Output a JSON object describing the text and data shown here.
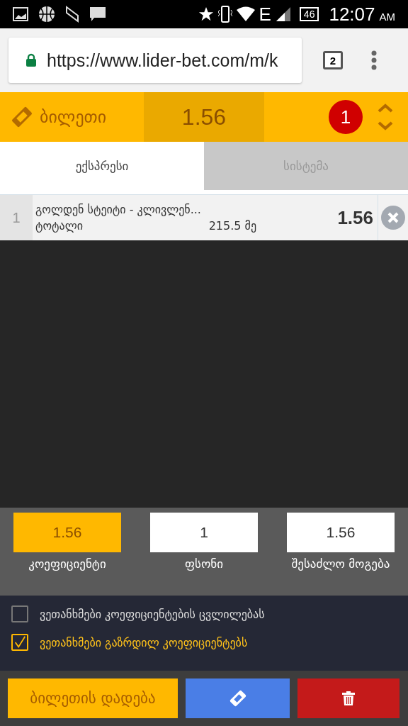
{
  "status_bar": {
    "network": "E",
    "battery": "46",
    "time": "12:07",
    "ampm": "AM"
  },
  "browser": {
    "url": "https://www.lider-bet.com/m/k",
    "tab_count": "2"
  },
  "header": {
    "title": "ბილეთი",
    "total_odds": "1.56",
    "count": "1"
  },
  "tabs": [
    {
      "label": "ექსპრესი",
      "selected": true
    },
    {
      "label": "სისტემა",
      "selected": false
    }
  ],
  "bets": [
    {
      "index": "1",
      "event": "გოლდენ სტეიტი - კლივლენ...",
      "market": "ტოტალი",
      "selection": "215.5 მე",
      "odds": "1.56"
    }
  ],
  "fields": [
    {
      "value": "1.56",
      "label": "კოეფიციენტი",
      "kind": "highlight"
    },
    {
      "value": "1",
      "label": "ფსონი",
      "kind": "input"
    },
    {
      "value": "1.56",
      "label": "შესაძლო მოგება",
      "kind": "input"
    }
  ],
  "options": [
    {
      "label": "ვეთანხმები კოეფიციენტების ცვლილებას",
      "checked": false
    },
    {
      "label": "ვეთანხმები გაზრდილ კოეფიციენტებს",
      "checked": true
    }
  ],
  "actions": {
    "place": "ბილეთის დადება"
  }
}
